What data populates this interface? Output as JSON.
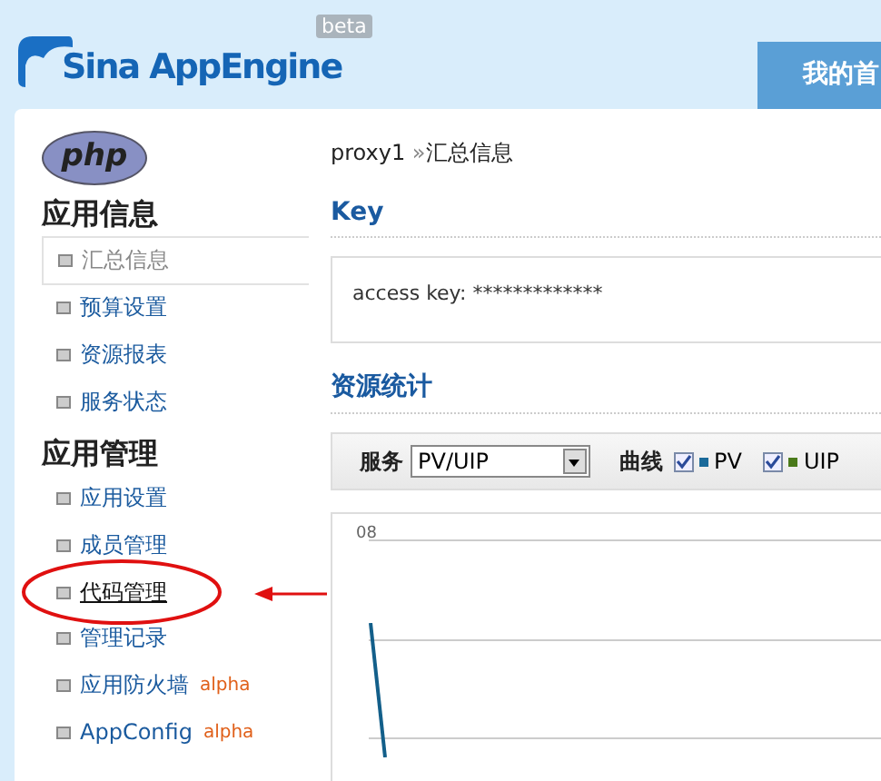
{
  "header": {
    "logo": "Sina AppEngine",
    "badge": "beta",
    "nav_tab": "我的首"
  },
  "sidebar": {
    "logo": "php",
    "sections": [
      {
        "title": "应用信息",
        "items": [
          {
            "label": "汇总信息",
            "selected": true,
            "hover": false,
            "circled": false
          },
          {
            "label": "预算设置",
            "selected": false,
            "hover": false,
            "circled": false
          },
          {
            "label": "资源报表",
            "selected": false,
            "hover": false,
            "circled": false
          },
          {
            "label": "服务状态",
            "selected": false,
            "hover": false,
            "circled": false
          }
        ]
      },
      {
        "title": "应用管理",
        "items": [
          {
            "label": "应用设置",
            "selected": false,
            "hover": false,
            "circled": false
          },
          {
            "label": "成员管理",
            "selected": false,
            "hover": false,
            "circled": false
          },
          {
            "label": "代码管理",
            "selected": false,
            "hover": true,
            "circled": true
          },
          {
            "label": "管理记录",
            "selected": false,
            "hover": false,
            "circled": false
          },
          {
            "label": "应用防火墙",
            "badge": "alpha",
            "selected": false,
            "hover": false,
            "circled": false
          },
          {
            "label": "AppConfig",
            "badge": "alpha",
            "selected": false,
            "hover": false,
            "circled": false
          }
        ]
      }
    ]
  },
  "breadcrumb": {
    "app": "proxy1",
    "separator": "»",
    "page": "汇总信息"
  },
  "key_section": {
    "title": "Key",
    "text": "access key: *************"
  },
  "stats_section": {
    "title": "资源统计",
    "service_label": "服务",
    "service_value": "PV/UIP",
    "curve_label": "曲线",
    "series": [
      {
        "label": "PV",
        "checked": true,
        "color": "#1a6a9a"
      },
      {
        "label": "UIP",
        "checked": true,
        "color": "#4a7a1a"
      }
    ],
    "chart": {
      "axis_label": "08"
    }
  }
}
